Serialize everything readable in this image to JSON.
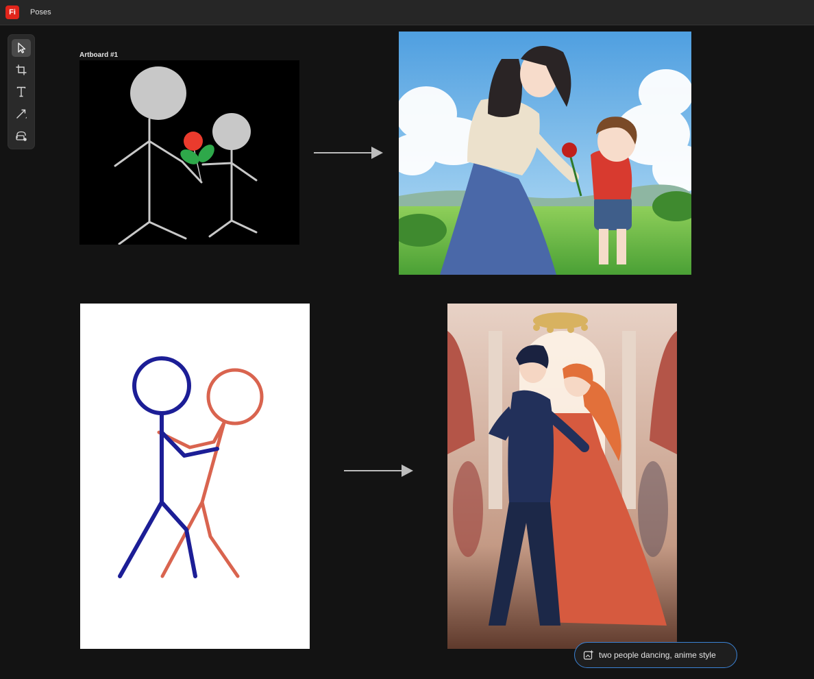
{
  "app": {
    "logo_text": "Fi",
    "document_title": "Poses",
    "brand_color": "#e1251b"
  },
  "toolbar": {
    "tools": [
      {
        "name": "select-tool",
        "icon": "pointer-arrow-icon",
        "active": true
      },
      {
        "name": "crop-tool",
        "icon": "crop-icon",
        "active": false
      },
      {
        "name": "text-tool",
        "icon": "text-t-icon",
        "active": false
      },
      {
        "name": "line-tool",
        "icon": "diagonal-line-icon",
        "active": false
      },
      {
        "name": "generate-tool",
        "icon": "image-generate-icon",
        "active": false
      }
    ]
  },
  "canvas": {
    "artboard_label": "Artboard #1"
  },
  "prompt": {
    "text": "two people dancing, anime style",
    "icon": "sparkle-generate-icon",
    "border_color": "#3b83d6"
  }
}
